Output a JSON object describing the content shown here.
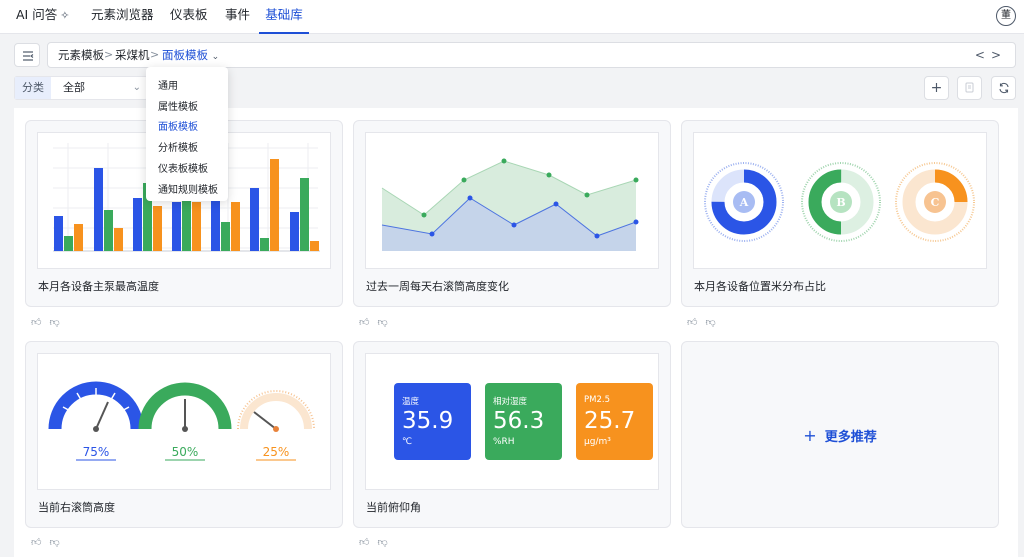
{
  "nav": {
    "tabs": [
      {
        "label": "AI 问答"
      },
      {
        "label": "元素浏览器"
      },
      {
        "label": "仪表板"
      },
      {
        "label": "事件"
      },
      {
        "label": "基础库"
      }
    ],
    "active_tab": "基础库",
    "avatar_text": "董"
  },
  "breadcrumb": {
    "items": [
      "元素模板",
      "采煤机",
      "面板模板"
    ],
    "separator": ">"
  },
  "filter": {
    "label": "分类",
    "value": "全部"
  },
  "dropdown": {
    "options": [
      "通用",
      "属性模板",
      "面板模板",
      "分析模板",
      "仪表板模板",
      "通知规则模板"
    ],
    "selected": "面板模板"
  },
  "cards": [
    {
      "title": "本月各设备主泵最高温度"
    },
    {
      "title": "过去一周每天右滚筒高度变化"
    },
    {
      "title": "本月各设备位置米分布占比"
    },
    {
      "title": "当前右滚筒高度"
    },
    {
      "title": "当前俯仰角"
    }
  ],
  "more_label": "更多推荐",
  "gauges": {
    "values": [
      "75%",
      "50%",
      "25%"
    ]
  },
  "donuts": {
    "labels": [
      "A",
      "B",
      "C"
    ]
  },
  "tiles": [
    {
      "label": "温度",
      "value": "35.9",
      "unit": "℃",
      "color": "#2b55e6"
    },
    {
      "label": "相对湿度",
      "value": "56.3",
      "unit": "%RH",
      "color": "#3aaa5c"
    },
    {
      "label": "PM2.5",
      "value": "25.7",
      "unit": "μg/m³",
      "color": "#f7921e"
    }
  ],
  "colors": {
    "accent": "#1e4fd6",
    "blue": "#2b55e6",
    "green": "#3aaa5c",
    "orange": "#f7921e"
  }
}
